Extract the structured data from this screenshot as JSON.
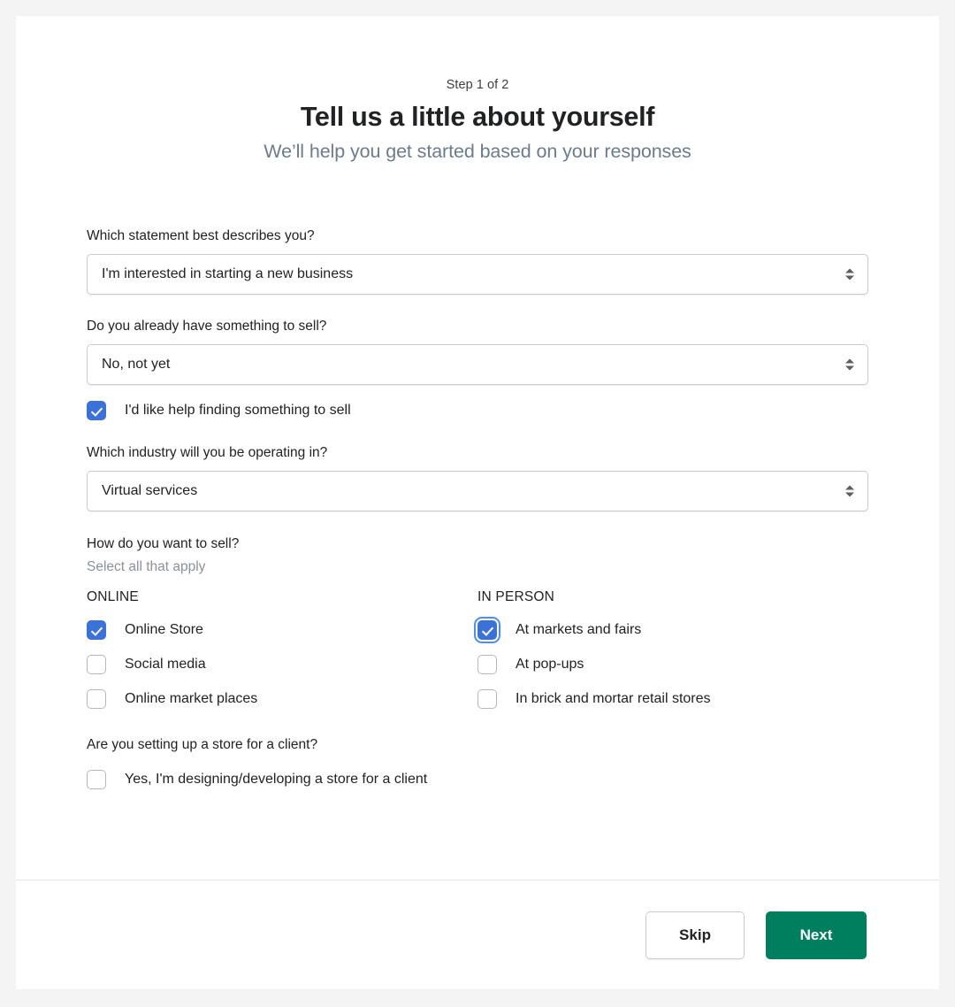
{
  "header": {
    "step_label": "Step 1 of 2",
    "title": "Tell us a little about yourself",
    "subtitle": "We’ll help you get started based on your responses"
  },
  "form": {
    "q1": {
      "label": "Which statement best describes you?",
      "selected": "I'm interested in starting a new business"
    },
    "q2": {
      "label": "Do you already have something to sell?",
      "selected": "No, not yet",
      "checkbox": {
        "label": "I'd like help finding something to sell",
        "checked": true
      }
    },
    "q3": {
      "label": "Which industry will you be operating in?",
      "selected": "Virtual services"
    },
    "q4": {
      "label": "How do you want to sell?",
      "helper": "Select all that apply",
      "online": {
        "heading": "ONLINE",
        "options": [
          {
            "label": "Online Store",
            "checked": true
          },
          {
            "label": "Social media",
            "checked": false
          },
          {
            "label": "Online market places",
            "checked": false
          }
        ]
      },
      "in_person": {
        "heading": "IN PERSON",
        "options": [
          {
            "label": "At markets and fairs",
            "checked": true,
            "focused": true
          },
          {
            "label": "At pop-ups",
            "checked": false
          },
          {
            "label": "In brick and mortar retail stores",
            "checked": false
          }
        ]
      }
    },
    "q5": {
      "label": "Are you setting up a store for a client?",
      "checkbox": {
        "label": "Yes, I'm designing/developing a store for a client",
        "checked": false
      }
    }
  },
  "footer": {
    "skip_label": "Skip",
    "next_label": "Next"
  },
  "colors": {
    "page_background": "#f4f4f5",
    "card_background": "#ffffff",
    "checkbox_accent": "#3b72d9",
    "focus_ring": "#4f8df5",
    "primary_button": "#007f5f",
    "title_text": "#202223",
    "subtitle_text": "#6b7c8d",
    "helper_text": "#8c9196",
    "border": "#c9cccf",
    "divider": "#e4e5e7"
  },
  "icons": {
    "select_stepper": "stepper-arrows-icon",
    "checkmark": "check-icon"
  }
}
